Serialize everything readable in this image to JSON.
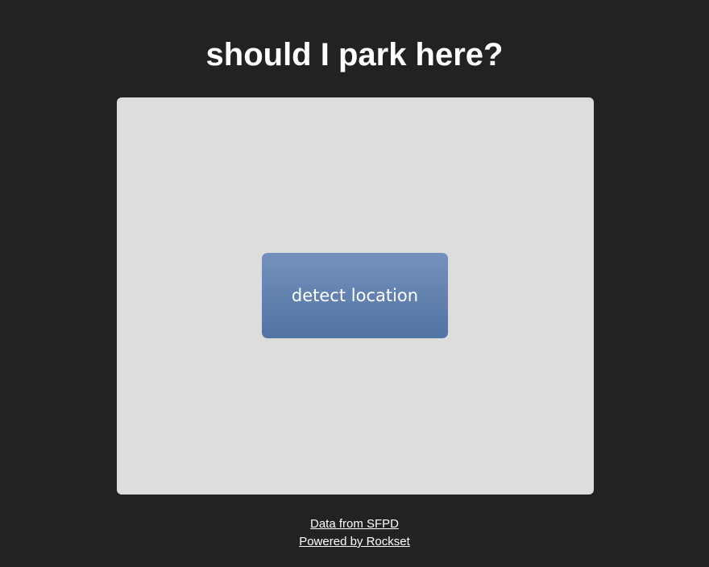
{
  "header": {
    "title": "should I park here?"
  },
  "main": {
    "detect_button_label": "detect location"
  },
  "footer": {
    "data_link": "Data from SFPD",
    "powered_link": "Powered by Rockset"
  },
  "colors": {
    "background": "#222222",
    "panel": "#dddddd",
    "button_top": "#7590bd",
    "button_bottom": "#5274a3"
  }
}
